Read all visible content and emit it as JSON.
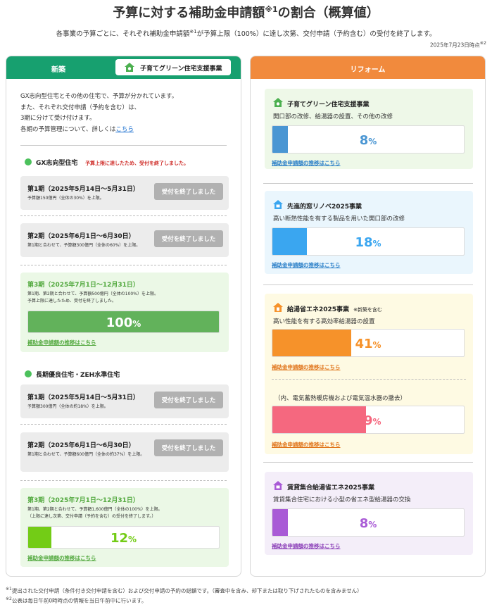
{
  "header": {
    "title": "予算に対する補助金申請額",
    "title_sup": "※1",
    "title_tail": "の割合（概算値）",
    "subtitle_a": "各事業の予算ごとに、それぞれ補助金申請額",
    "subtitle_sup": "※1",
    "subtitle_b": "が予算上限（100%）に達し次第、交付申請（予約含む）の受付を終了します。",
    "asof": "2025年7月23日時点",
    "asof_sup": "※2"
  },
  "left": {
    "tab": "新築",
    "program_tag": "子育てグリーン住宅支援事業",
    "intro": [
      "GX志向型住宅とその他の住宅で、予算が分かれています。",
      "また、それぞれ交付申請（予約を含む）は、",
      "3期に分けて受け付けます。"
    ],
    "intro_last": "各期の予算管理について、詳しくは",
    "intro_link": "こちら",
    "closed_label": "受付を終了しました",
    "link_label": "補助金申請額の推移はこちら",
    "gx": {
      "title": "GX志向型住宅",
      "note": "予算上限に達したため、受付を終了しました。",
      "p1": {
        "title": "第1期（2025年5月14日～5月31日）",
        "sub": "予算額150億円（全体の30%）を上限。"
      },
      "p2": {
        "title": "第2期（2025年6月1日～6月30日）",
        "sub": "第1期と合わせて、予算額300億円（全体の60%）を上限。"
      },
      "p3": {
        "title": "第3期（2025年7月1日～12月31日）",
        "sub1": "第1期、第2期と合わせて、予算額500億円（全体の100%）を上限。",
        "sub2": "予算上限に達したため、受付を終了しました。",
        "value": 100,
        "pct": "100",
        "unit": "%",
        "color": "#62b25b"
      }
    },
    "zeh": {
      "title": "長期優良住宅・ZEH水準住宅",
      "p1": {
        "title": "第1期（2025年5月14日～5月31日）",
        "sub": "予算額300億円（全体の約18%）を上限。"
      },
      "p2": {
        "title": "第2期（2025年6月1日～6月30日）",
        "sub": "第1期と合わせて、予算額600億円（全体の約37%）を上限。"
      },
      "p3": {
        "title": "第3期（2025年7月1日～12月31日）",
        "sub1": "第1期、第2期と合わせて、予算額1,600億円（全体の100%）を上限。",
        "sub2": "（上限に達し次第、交付申請（予約を含む）の受付を終了します。）",
        "value": 12,
        "pct": "12",
        "unit": "%",
        "color": "#73cc16"
      }
    }
  },
  "right": {
    "tab": "リフォーム",
    "link_label": "補助金申請額の推移はこちら",
    "programs": [
      {
        "title": "子育てグリーン住宅支援事業",
        "desc": "開口部の改修、給湯器の設置、その他の改修",
        "value": 8,
        "pct": "8",
        "unit": "%",
        "color": "#4a96d3"
      },
      {
        "title": "先進的窓リノベ2025事業",
        "desc": "高い断熱性能を有する製品を用いた開口部の改修",
        "value": 18,
        "pct": "18",
        "unit": "%",
        "color": "#3aa6f0"
      },
      {
        "title": "給湯省エネ2025事業",
        "note": "※新築を含む",
        "desc": "高い性能を有する高効率給湯器の設置",
        "value": 41,
        "pct": "41",
        "unit": "%",
        "color": "#f6922a"
      },
      {
        "desc": "（内、電気蓄熱暖房機および電気温水器の撤去）",
        "value": 49,
        "pct": "49",
        "unit": "%",
        "color": "#f5687f"
      },
      {
        "title": "賃貸集合給湯省エネ2025事業",
        "desc": "賃貸集合住宅における小型の省エネ型給湯器の交換",
        "value": 8,
        "pct": "8",
        "unit": "%",
        "color": "#a95bd6"
      }
    ]
  },
  "footnotes": [
    "提出された交付申請（条件付き交付申請を含む）および交付申請の予約の総額です。（審査中を含み、却下または取り下げされたものを含みません）",
    "公表は毎日午前0時時点の情報を当日午前中に行います。"
  ],
  "footnote_marks": [
    "※1",
    "※2"
  ]
}
